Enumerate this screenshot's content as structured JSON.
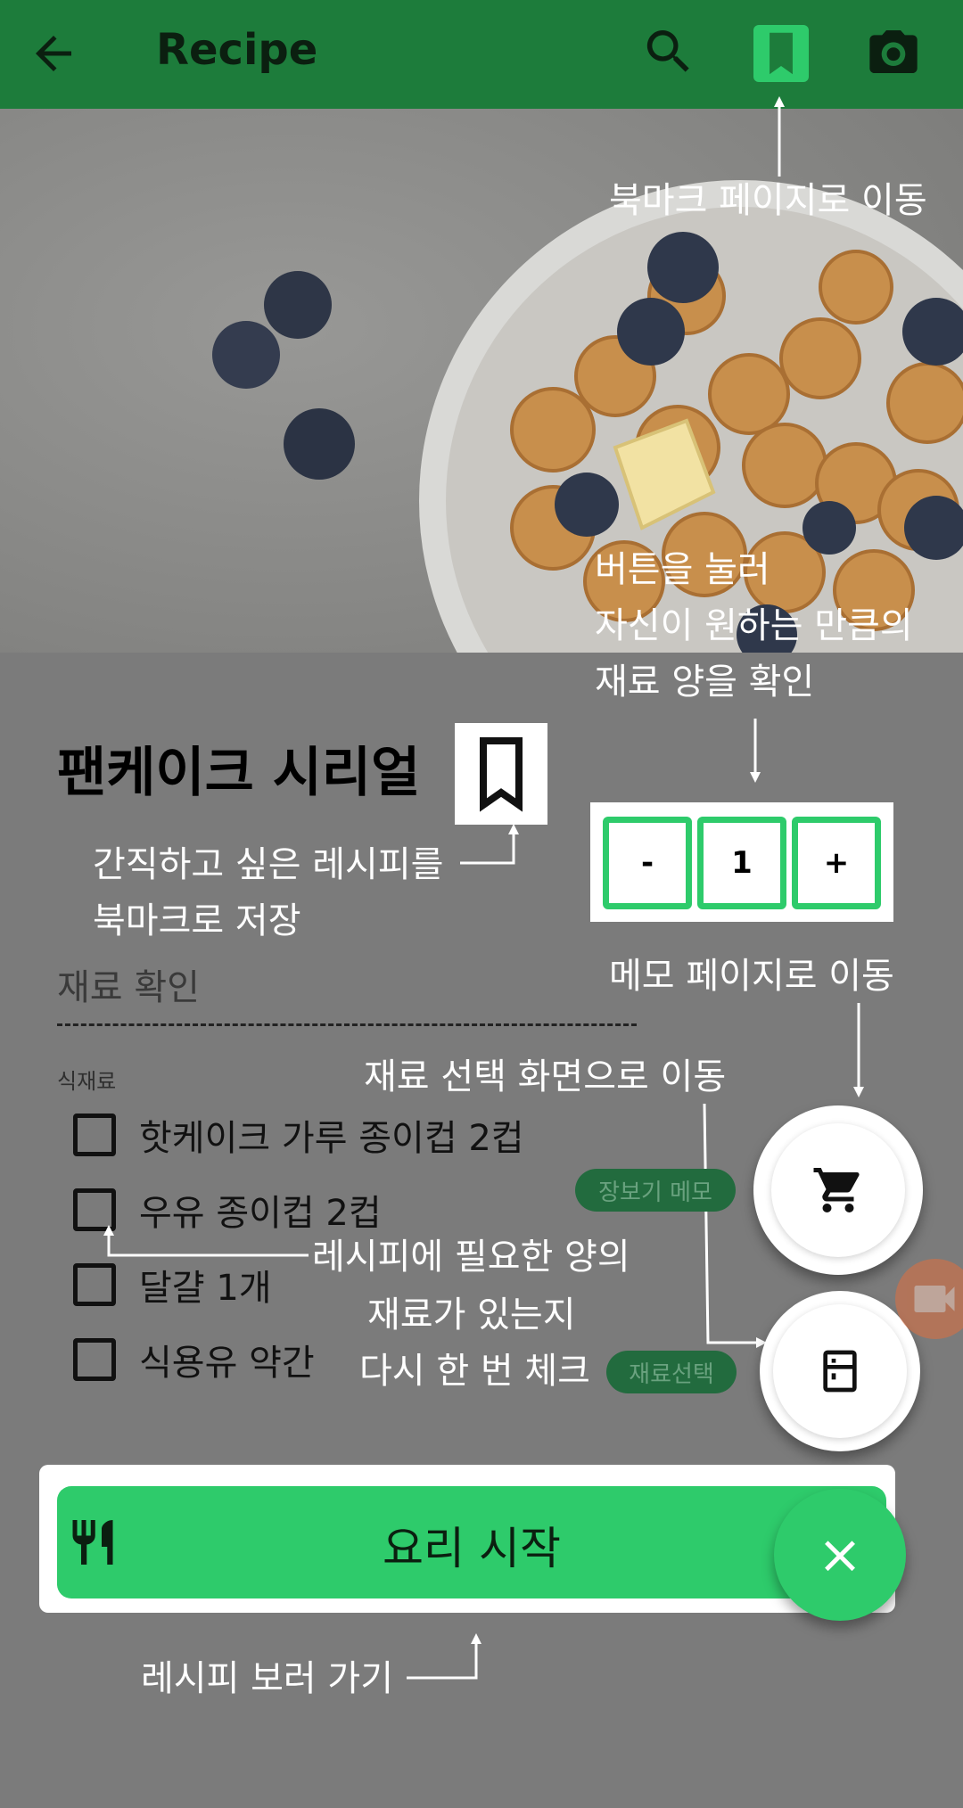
{
  "app_bar": {
    "title": "Recipe",
    "back_icon": "arrow-back-icon",
    "search_icon": "search-icon",
    "bookmark_icon": "bookmark-icon",
    "camera_icon": "camera-icon",
    "color": "#1d7c3b",
    "accent": "#2ecb6b"
  },
  "annotations": {
    "bookmark_page": "북마크 페이지로 이동",
    "servings_line1": "버튼을 눌러",
    "servings_line2": "자신이 원하는 만큼의",
    "servings_line3": "재료 양을 확인",
    "save_line1": "간직하고 싶은 레시피를",
    "save_line2": "북마크로 저장",
    "memo_page": "메모 페이지로 이동",
    "ingredient_select": "재료 선택 화면으로 이동",
    "check_line1": "레시피에 필요한 양의",
    "check_line2": "재료가 있는지",
    "check_line3": "다시 한 번 체크",
    "go_recipe": "레시피 보러 가기"
  },
  "recipe": {
    "title": "팬케이크 시리얼",
    "section_label": "재료 확인",
    "dashes": "------------------------------------------------------",
    "ingredients_label": "식재료",
    "ingredients": [
      {
        "name": "핫케이크 가루 종이컵 2컵",
        "checked": false
      },
      {
        "name": "우유 종이컵 2컵",
        "checked": false
      },
      {
        "name": "달걀 1개",
        "checked": false
      },
      {
        "name": "식용유 약간",
        "checked": false
      }
    ]
  },
  "servings": {
    "minus": "-",
    "value": "1",
    "plus": "+"
  },
  "fab_menu": {
    "memo_chip": "장보기 메모",
    "select_chip": "재료선택",
    "memo_icon": "cart-icon",
    "select_icon": "fridge-icon",
    "video_icon": "video-icon",
    "close": "×"
  },
  "start_button": {
    "label": "요리 시작",
    "icon": "utensils-icon"
  }
}
